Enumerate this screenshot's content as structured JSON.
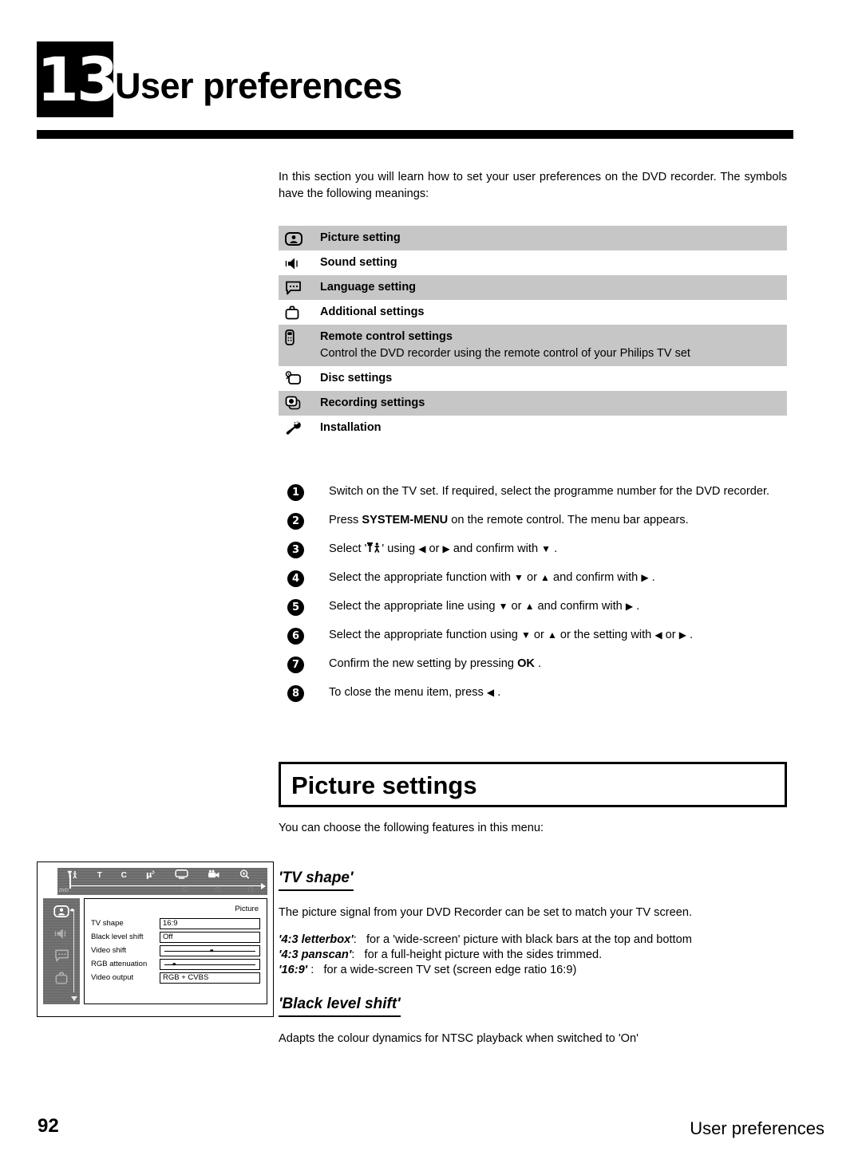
{
  "header": {
    "chapter_number": "13",
    "chapter_title": "User preferences"
  },
  "intro": "In this section you will learn how to set your user preferences on the DVD recorder. The symbols have the following meanings:",
  "symbol_table": {
    "rows": [
      {
        "icon": "picture-setting-icon",
        "label": "Picture setting",
        "desc": "",
        "shaded": true
      },
      {
        "icon": "sound-setting-icon",
        "label": "Sound setting",
        "desc": "",
        "shaded": false
      },
      {
        "icon": "language-setting-icon",
        "label": "Language setting",
        "desc": "",
        "shaded": true
      },
      {
        "icon": "additional-settings-icon",
        "label": "Additional settings",
        "desc": "",
        "shaded": false
      },
      {
        "icon": "remote-control-icon",
        "label": "Remote control settings",
        "desc": "Control the DVD recorder using the remote control of your Philips TV set",
        "shaded": true
      },
      {
        "icon": "disc-settings-icon",
        "label": "Disc settings",
        "desc": "",
        "shaded": false
      },
      {
        "icon": "recording-settings-icon",
        "label": "Recording settings",
        "desc": "",
        "shaded": true
      },
      {
        "icon": "installation-icon",
        "label": "Installation",
        "desc": "",
        "shaded": false
      }
    ]
  },
  "steps": [
    {
      "num": "1",
      "text": "Switch on the TV set. If required, select the programme number for the DVD recorder."
    },
    {
      "num": "2",
      "text": "Press SYSTEM-MENU on the remote control. The menu bar appears."
    },
    {
      "num": "3",
      "text": "Select 'TA' using ◀ or ▶ and confirm with ▼ ."
    },
    {
      "num": "4",
      "text": "Select the appropriate function with ▼ or ▲ and confirm with ▶ ."
    },
    {
      "num": "5",
      "text": "Select the appropriate line using ▼ or ▲ and confirm with ▶ ."
    },
    {
      "num": "6",
      "text": "Select the appropriate function using ▼ or ▲ or the setting with ◀ or ▶ ."
    },
    {
      "num": "7",
      "text": "Confirm the new setting by pressing OK ."
    },
    {
      "num": "8",
      "text": "To close the menu item, press ◀ ."
    }
  ],
  "step_parts": {
    "s2_a": "Press",
    "s2_key": "SYSTEM-MENU",
    "s2_b": "on the remote control. The menu bar appears.",
    "s3_a": "Select '",
    "s3_b": "' using",
    "s3_or": "or",
    "s3_c": "and confirm with",
    "s3_end": ".",
    "s4_a": "Select the appropriate function with",
    "s4_or": "or",
    "s4_b": "and confirm with",
    "s4_end": ".",
    "s5_a": "Select the appropriate line using",
    "s5_or": "or",
    "s5_b": "and confirm with",
    "s5_end": ".",
    "s6_a": "Select the appropriate function using",
    "s6_or": "or",
    "s6_b": "or the setting with",
    "s6_or2": "or",
    "s6_end": ".",
    "s7_a": "Confirm the new setting by pressing",
    "s7_key": "OK",
    "s7_end": ".",
    "s8_a": "To close the menu item, press",
    "s8_end": "."
  },
  "section": {
    "title": "Picture settings",
    "intro": "You can choose the following features in this menu:"
  },
  "features": [
    {
      "title": "'TV shape'",
      "body": "The picture signal from your DVD Recorder can be set to match your TV screen.",
      "options": [
        {
          "key": "'4:3 letterbox'",
          "sep": ":",
          "desc": "for a 'wide-screen' picture with black bars at the top and bottom"
        },
        {
          "key": "'4:3 panscan'",
          "sep": ":",
          "desc": "for a full-height picture with the sides trimmed."
        },
        {
          "key": "'16:9'",
          "sep": " :",
          "desc": "for a wide-screen TV set (screen edge ratio 16:9)"
        }
      ]
    },
    {
      "title": "'Black level shift'",
      "body": "Adapts the colour dynamics for NTSC playback when switched to 'On'",
      "options": []
    }
  ],
  "tv_mockup": {
    "menubar": {
      "icons": [
        "TA",
        "T",
        "C",
        "µ",
        "screen",
        "camera",
        "magnifier"
      ],
      "sub_icons": [
        "",
        "",
        "",
        "",
        "sub1",
        "sub2",
        "sub3"
      ],
      "logo": "DVD"
    },
    "sidebar_icons": [
      "picture-setting-icon",
      "sound-setting-icon",
      "language-setting-icon",
      "additional-settings-icon"
    ],
    "panel_title": "Picture",
    "settings": [
      {
        "label": "TV shape",
        "type": "text",
        "value": "16:9"
      },
      {
        "label": "Black level shift",
        "type": "text",
        "value": "Off"
      },
      {
        "label": "Video shift",
        "type": "slider",
        "value": "",
        "position": 52
      },
      {
        "label": "RGB attenuation",
        "type": "slider",
        "value": "",
        "position": 14
      },
      {
        "label": "Video output",
        "type": "text",
        "value": "RGB + CVBS"
      }
    ]
  },
  "footer": {
    "page_number": "92",
    "title": "User preferences"
  },
  "colors": {
    "shade": "#c6c6c6",
    "screen_gray": "#6d6d6d",
    "black": "#000000"
  }
}
